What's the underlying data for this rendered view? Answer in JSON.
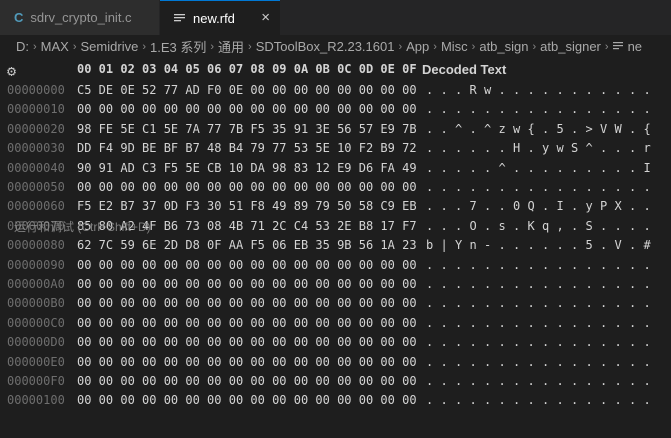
{
  "tabs": [
    {
      "label": "sdrv_crypto_init.c",
      "icon": "c-file-icon"
    },
    {
      "label": "new.rfd",
      "icon": "text-file-icon",
      "close": "×"
    }
  ],
  "breadcrumb": [
    "D:",
    "MAX",
    "Semidrive",
    "1.E3 系列",
    "通用",
    "SDToolBox_R2.23.1601",
    "App",
    "Misc",
    "atb_sign",
    "atb_signer",
    "ne"
  ],
  "hex": {
    "header_bytes": "00 01 02 03 04 05 06 07 08 09 0A 0B 0C 0D 0E 0F",
    "header_decoded": "Decoded Text",
    "tooltip": "运行和调试 (Ctrl+Shift+D)",
    "rows": [
      {
        "addr": "00000000",
        "bytes": "C5 DE 0E 52 77 AD F0 0E 00 00 00 00 00 00 00 00",
        "dec": [
          ".",
          ".",
          ".",
          "R",
          "w",
          ".",
          ".",
          ".",
          ".",
          ".",
          ".",
          ".",
          ".",
          ".",
          ".",
          "."
        ]
      },
      {
        "addr": "00000010",
        "bytes": "00 00 00 00 00 00 00 00 00 00 00 00 00 00 00 00",
        "dec": [
          ".",
          ".",
          ".",
          ".",
          ".",
          ".",
          ".",
          ".",
          ".",
          ".",
          ".",
          ".",
          ".",
          ".",
          ".",
          "."
        ]
      },
      {
        "addr": "00000020",
        "bytes": "98 FE 5E C1 5E 7A 77 7B F5 35 91 3E 56 57 E9 7B",
        "dec": [
          ".",
          ".",
          "^",
          ".",
          "^",
          "z",
          "w",
          "{",
          ".",
          "5",
          ".",
          ">",
          "V",
          "W",
          ".",
          "{"
        ]
      },
      {
        "addr": "00000030",
        "bytes": "DD F4 9D BE BF B7 48 B4 79 77 53 5E 10 F2 B9 72",
        "dec": [
          ".",
          ".",
          ".",
          ".",
          ".",
          ".",
          "H",
          ".",
          "y",
          "w",
          "S",
          "^",
          ".",
          ".",
          ".",
          "r"
        ]
      },
      {
        "addr": "00000040",
        "bytes": "90 91 AD C3 F5 5E CB 10 DA 98 83 12 E9 D6 FA 49",
        "dec": [
          ".",
          ".",
          ".",
          ".",
          ".",
          "^",
          ".",
          ".",
          ".",
          ".",
          ".",
          ".",
          ".",
          ".",
          ".",
          "I"
        ]
      },
      {
        "addr": "00000050",
        "bytes": "00 00 00 00 00 00 00 00 00 00 00 00 00 00 00 00",
        "dec": [
          ".",
          ".",
          ".",
          ".",
          ".",
          ".",
          ".",
          ".",
          ".",
          ".",
          ".",
          ".",
          ".",
          ".",
          ".",
          "."
        ]
      },
      {
        "addr": "00000060",
        "bytes": "F5 E2 B7 37 0D F3 30 51 F8 49 89 79 50 58 C9 EB",
        "dec": [
          ".",
          ".",
          ".",
          "7",
          ".",
          ".",
          "0",
          "Q",
          ".",
          "I",
          ".",
          "y",
          "P",
          "X",
          ".",
          "."
        ]
      },
      {
        "addr": "00000070",
        "bytes": "85 80 A2 4F B6 73 08 4B 71 2C C4 53 2E B8 17 F7",
        "dec": [
          ".",
          ".",
          ".",
          "O",
          ".",
          "s",
          ".",
          "K",
          "q",
          ",",
          ".",
          "S",
          ".",
          ".",
          ".",
          "."
        ]
      },
      {
        "addr": "00000080",
        "bytes": "62 7C 59 6E 2D D8 0F AA F5 06 EB 35 9B 56 1A 23",
        "dec": [
          "b",
          "|",
          "Y",
          "n",
          "-",
          ".",
          ".",
          ".",
          ".",
          ".",
          ".",
          "5",
          ".",
          "V",
          ".",
          "#"
        ]
      },
      {
        "addr": "00000090",
        "bytes": "00 00 00 00 00 00 00 00 00 00 00 00 00 00 00 00",
        "dec": [
          ".",
          ".",
          ".",
          ".",
          ".",
          ".",
          ".",
          ".",
          ".",
          ".",
          ".",
          ".",
          ".",
          ".",
          ".",
          "."
        ]
      },
      {
        "addr": "000000A0",
        "bytes": "00 00 00 00 00 00 00 00 00 00 00 00 00 00 00 00",
        "dec": [
          ".",
          ".",
          ".",
          ".",
          ".",
          ".",
          ".",
          ".",
          ".",
          ".",
          ".",
          ".",
          ".",
          ".",
          ".",
          "."
        ]
      },
      {
        "addr": "000000B0",
        "bytes": "00 00 00 00 00 00 00 00 00 00 00 00 00 00 00 00",
        "dec": [
          ".",
          ".",
          ".",
          ".",
          ".",
          ".",
          ".",
          ".",
          ".",
          ".",
          ".",
          ".",
          ".",
          ".",
          ".",
          "."
        ]
      },
      {
        "addr": "000000C0",
        "bytes": "00 00 00 00 00 00 00 00 00 00 00 00 00 00 00 00",
        "dec": [
          ".",
          ".",
          ".",
          ".",
          ".",
          ".",
          ".",
          ".",
          ".",
          ".",
          ".",
          ".",
          ".",
          ".",
          ".",
          "."
        ]
      },
      {
        "addr": "000000D0",
        "bytes": "00 00 00 00 00 00 00 00 00 00 00 00 00 00 00 00",
        "dec": [
          ".",
          ".",
          ".",
          ".",
          ".",
          ".",
          ".",
          ".",
          ".",
          ".",
          ".",
          ".",
          ".",
          ".",
          ".",
          "."
        ]
      },
      {
        "addr": "000000E0",
        "bytes": "00 00 00 00 00 00 00 00 00 00 00 00 00 00 00 00",
        "dec": [
          ".",
          ".",
          ".",
          ".",
          ".",
          ".",
          ".",
          ".",
          ".",
          ".",
          ".",
          ".",
          ".",
          ".",
          ".",
          "."
        ]
      },
      {
        "addr": "000000F0",
        "bytes": "00 00 00 00 00 00 00 00 00 00 00 00 00 00 00 00",
        "dec": [
          ".",
          ".",
          ".",
          ".",
          ".",
          ".",
          ".",
          ".",
          ".",
          ".",
          ".",
          ".",
          ".",
          ".",
          ".",
          "."
        ]
      },
      {
        "addr": "00000100",
        "bytes": "00 00 00 00 00 00 00 00 00 00 00 00 00 00 00 00",
        "dec": [
          ".",
          ".",
          ".",
          ".",
          ".",
          ".",
          ".",
          ".",
          ".",
          ".",
          ".",
          ".",
          ".",
          ".",
          ".",
          "."
        ]
      }
    ]
  }
}
